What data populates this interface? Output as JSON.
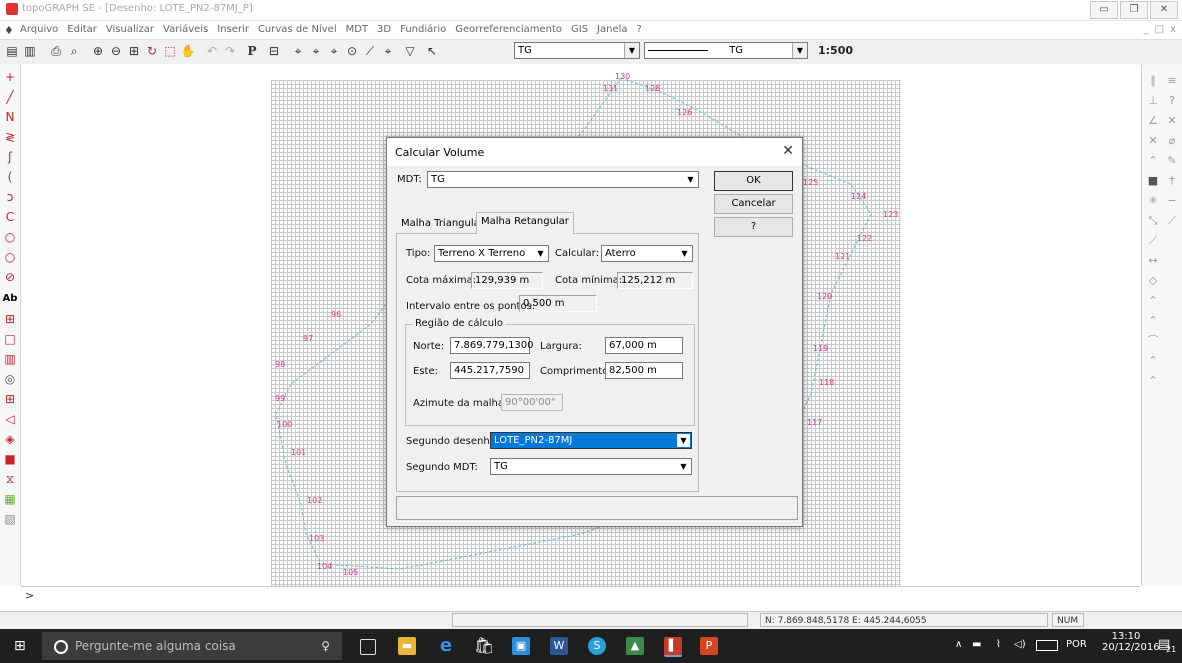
{
  "window": {
    "title": "topoGRAPH SE - [Desenho: LOTE_PN2-87MJ_P]",
    "minimize_icon": "minimize-icon",
    "restore_icon": "restore-icon",
    "close_icon": "close-icon"
  },
  "menu": {
    "items": [
      "Arquivo",
      "Editar",
      "Visualizar",
      "Variáveis",
      "Inserir",
      "Curvas de Nível",
      "MDT",
      "3D",
      "Fundiário",
      "Georreferenciamento",
      "GIS",
      "Janela",
      "?"
    ],
    "mdi_buttons": [
      "_",
      "□",
      "x"
    ]
  },
  "toolbar": {
    "layer_combo": "TG",
    "linetype_combo": "TG",
    "scale": "1:500"
  },
  "drawing": {
    "point_labels": [
      "130",
      "131",
      "128",
      "126",
      "125",
      "124",
      "123",
      "122",
      "121",
      "120",
      "119",
      "118",
      "117",
      "100",
      "101",
      "102",
      "103",
      "104",
      "105",
      "99",
      "98",
      "97",
      "96"
    ]
  },
  "dialog": {
    "title": "Calcular Volume",
    "mdt_label": "MDT:",
    "mdt_value": "TG",
    "buttons": {
      "ok": "OK",
      "cancel": "Cancelar",
      "help": "?"
    },
    "tabs": [
      "Malha Triangular",
      "Malha Retangular"
    ],
    "tipo_label": "Tipo:",
    "tipo_value": "Terreno X Terreno",
    "calcular_label": "Calcular:",
    "calcular_value": "Aterro",
    "cota_max_label": "Cota máxima:",
    "cota_max_value": "129,939 m",
    "cota_min_label": "Cota mínima:",
    "cota_min_value": "125,212 m",
    "intervalo_label": "Intervalo entre os pontos:",
    "intervalo_value": "0,500 m",
    "regiao_label": "Região de cálculo",
    "norte_label": "Norte:",
    "norte_value": "7.869.779,1300",
    "largura_label": "Largura:",
    "largura_value": "67,000 m",
    "este_label": "Este:",
    "este_value": "445.217,7590",
    "comprimento_label": "Comprimento:",
    "comprimento_value": "82,500 m",
    "azimute_label": "Azimute da malha:",
    "azimute_value": "90°00'00\"",
    "segundo_desenho_label": "Segundo desenho:",
    "segundo_desenho_value": "LOTE_PN2-87MJ",
    "segundo_mdt_label": "Segundo MDT:",
    "segundo_mdt_value": "TG"
  },
  "command": {
    "prompt": ">"
  },
  "status": {
    "coords": "N: 7.869.848,5178 E: 445.244,6055",
    "num": "NUM"
  },
  "taskbar": {
    "search_placeholder": "Pergunte-me alguma coisa",
    "language": "POR",
    "time": "13:10",
    "date": "20/12/2016",
    "notifications": "21"
  },
  "colors": {
    "accent_blue": "#0078d7",
    "point_label": "#d43b8a",
    "point_id": "#4aa657",
    "taskbar_bg": "#1f1f1f"
  }
}
